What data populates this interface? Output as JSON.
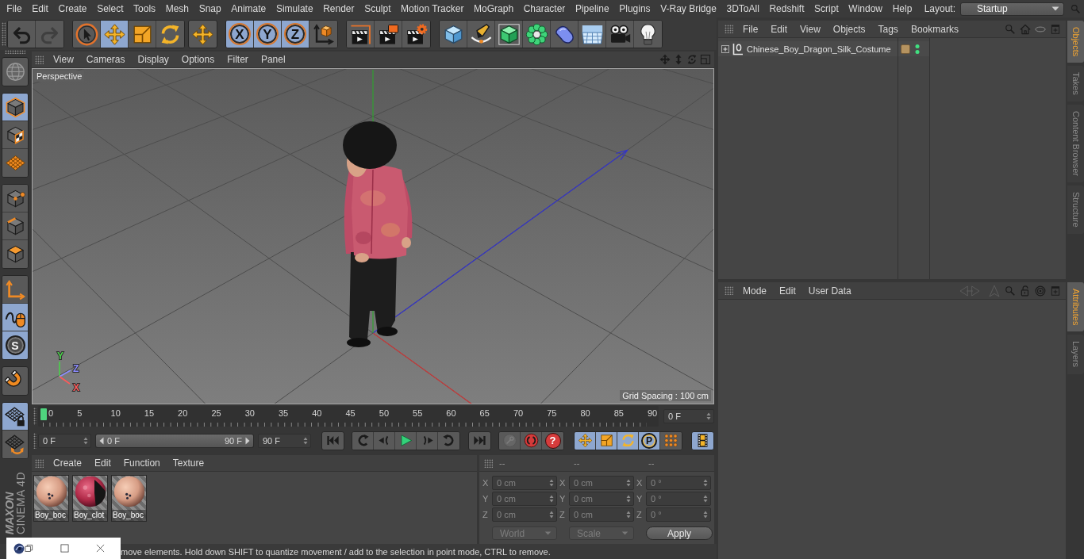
{
  "menu_bar": {
    "items": [
      "File",
      "Edit",
      "Create",
      "Select",
      "Tools",
      "Mesh",
      "Snap",
      "Animate",
      "Simulate",
      "Render",
      "Sculpt",
      "Motion Tracker",
      "MoGraph",
      "Character",
      "Pipeline",
      "Plugins",
      "V-Ray Bridge",
      "3DToAll",
      "Redshift",
      "Script",
      "Window",
      "Help"
    ],
    "layout_label": "Layout:",
    "layout_value": "Startup"
  },
  "toolbar": [
    [
      {
        "kind": "undo",
        "selected": false,
        "disabled": false
      },
      {
        "kind": "redo",
        "selected": false,
        "disabled": true
      }
    ],
    [
      {
        "kind": "select",
        "selected": false,
        "disabled": false
      },
      {
        "kind": "move",
        "selected": true,
        "disabled": false
      },
      {
        "kind": "scale",
        "selected": false,
        "disabled": false
      },
      {
        "kind": "rotate",
        "selected": false,
        "disabled": false
      }
    ],
    [
      {
        "kind": "move",
        "selected": false,
        "disabled": false
      }
    ],
    [
      {
        "kind": "axis",
        "label": "X",
        "selected": true,
        "disabled": false
      },
      {
        "kind": "axis",
        "label": "Y",
        "selected": true,
        "disabled": false
      },
      {
        "kind": "axis",
        "label": "Z",
        "selected": true,
        "disabled": false
      },
      {
        "kind": "world",
        "selected": false,
        "disabled": false
      }
    ],
    [
      {
        "kind": "render-view",
        "selected": false,
        "disabled": false
      },
      {
        "kind": "render-picture",
        "selected": false,
        "disabled": false
      },
      {
        "kind": "render-settings",
        "selected": false,
        "disabled": false
      }
    ],
    [
      {
        "kind": "cube",
        "selected": false,
        "disabled": false
      },
      {
        "kind": "pen",
        "selected": false,
        "disabled": false
      },
      {
        "kind": "subdivision",
        "selected": false,
        "disabled": false
      },
      {
        "kind": "cloner",
        "selected": false,
        "disabled": false
      },
      {
        "kind": "deformer",
        "selected": false,
        "disabled": false
      },
      {
        "kind": "floor",
        "selected": false,
        "disabled": false
      },
      {
        "kind": "camera",
        "selected": false,
        "disabled": false
      },
      {
        "kind": "light",
        "selected": false,
        "disabled": false
      }
    ]
  ],
  "left_toolbar": [
    [
      {
        "kind": "view",
        "selected": false
      }
    ],
    [
      {
        "kind": "model",
        "selected": true
      },
      {
        "kind": "texture",
        "selected": false
      },
      {
        "kind": "workplane",
        "selected": false
      }
    ],
    [
      {
        "kind": "points",
        "selected": false
      },
      {
        "kind": "edges",
        "selected": false
      },
      {
        "kind": "polygons",
        "selected": false
      }
    ],
    [
      {
        "kind": "axis-mode",
        "selected": false
      },
      {
        "kind": "tweak",
        "selected": true
      },
      {
        "kind": "solo",
        "label": "S",
        "selected": true
      }
    ],
    [
      {
        "kind": "snap",
        "selected": false
      }
    ],
    [
      {
        "kind": "workplane-lock",
        "selected": true
      },
      {
        "kind": "workplane-rotate",
        "selected": false
      }
    ]
  ],
  "logo": {
    "brand": "MAXON",
    "product": "CINEMA 4D"
  },
  "viewport": {
    "menu": [
      "View",
      "Cameras",
      "Display",
      "Options",
      "Filter",
      "Panel"
    ],
    "camera": "Perspective",
    "grid_spacing": "Grid Spacing : 100 cm",
    "gizmo": [
      {
        "label": "Y",
        "color": "#4cd04c"
      },
      {
        "label": "Z",
        "color": "#8c8cff"
      },
      {
        "label": "X",
        "color": "#ff5a5a"
      }
    ]
  },
  "timeline": {
    "ticks": [
      "0",
      "5",
      "10",
      "15",
      "20",
      "25",
      "30",
      "35",
      "40",
      "45",
      "50",
      "55",
      "60",
      "65",
      "70",
      "75",
      "80",
      "85",
      "90"
    ],
    "level": 0,
    "current_frame": "0 F",
    "start": "0 F",
    "range": {
      "start": "0 F",
      "end": "90 F",
      "level": 1
    },
    "end": "90 F"
  },
  "transport": [
    [
      {
        "kind": "go-start",
        "selected": false,
        "disabled": false
      }
    ],
    [
      {
        "kind": "prev-key",
        "selected": false,
        "disabled": false
      },
      {
        "kind": "prev-frame",
        "selected": false,
        "disabled": false
      },
      {
        "kind": "play",
        "selected": false,
        "disabled": false
      },
      {
        "kind": "next-frame",
        "selected": false,
        "disabled": false
      },
      {
        "kind": "next-key",
        "selected": false,
        "disabled": false
      }
    ],
    [
      {
        "kind": "go-end",
        "selected": false,
        "disabled": false
      }
    ],
    [
      {
        "kind": "record",
        "selected": false,
        "disabled": true
      },
      {
        "kind": "autokey",
        "selected": false,
        "disabled": false
      },
      {
        "kind": "key-select",
        "label": "?",
        "selected": false,
        "disabled": false
      }
    ],
    [
      {
        "kind": "move-key",
        "selected": true,
        "disabled": false
      },
      {
        "kind": "scale-key",
        "selected": true,
        "disabled": false
      },
      {
        "kind": "rotate-key",
        "selected": true,
        "disabled": false
      },
      {
        "kind": "pla",
        "label": "P",
        "selected": true,
        "disabled": false
      },
      {
        "kind": "param",
        "selected": false,
        "disabled": false
      }
    ],
    [
      {
        "kind": "film",
        "selected": true,
        "disabled": false
      }
    ]
  ],
  "material_manager": {
    "menu": [
      "Create",
      "Edit",
      "Function",
      "Texture"
    ],
    "materials": [
      {
        "name": "Boy_boc",
        "kind": "skin"
      },
      {
        "name": "Boy_clot",
        "kind": "cloth"
      },
      {
        "name": "Boy_boc",
        "kind": "skin"
      }
    ]
  },
  "coordinates": {
    "disabled": true,
    "headers": [
      "--",
      "--",
      "--"
    ],
    "rows": [
      {
        "cells": [
          {
            "axis": "X",
            "value": "0 cm"
          },
          {
            "axis": "X",
            "value": "0 cm"
          },
          {
            "axis": "X",
            "value": "0 °"
          }
        ]
      },
      {
        "cells": [
          {
            "axis": "Y",
            "value": "0 cm"
          },
          {
            "axis": "Y",
            "value": "0 cm"
          },
          {
            "axis": "Y",
            "value": "0 °"
          }
        ]
      },
      {
        "cells": [
          {
            "axis": "Z",
            "value": "0 cm"
          },
          {
            "axis": "Z",
            "value": "0 cm"
          },
          {
            "axis": "Z",
            "value": "0 °"
          }
        ]
      }
    ],
    "mode": "World",
    "transform": "Scale",
    "apply": "Apply"
  },
  "status_bar": {
    "text": "move elements. Hold down SHIFT to quantize movement / add to the selection in point mode, CTRL to remove."
  },
  "object_manager": {
    "menu": [
      "File",
      "Edit",
      "View",
      "Objects",
      "Tags",
      "Bookmarks"
    ],
    "objects": [
      {
        "name": "Chinese_Boy_Dragon_Silk_Costume",
        "expanded": false,
        "selected": false
      }
    ]
  },
  "attribute_manager": {
    "menu": [
      "Mode",
      "Edit",
      "User Data"
    ]
  },
  "side_tabs": {
    "top": [
      {
        "label": "Objects",
        "selected": true
      },
      {
        "label": "Takes",
        "selected": false
      },
      {
        "label": "Content Browser",
        "selected": false
      },
      {
        "label": "Structure",
        "selected": false
      }
    ],
    "bottom": [
      {
        "label": "Attributes",
        "selected": true
      },
      {
        "label": "Layers",
        "selected": false
      }
    ]
  }
}
